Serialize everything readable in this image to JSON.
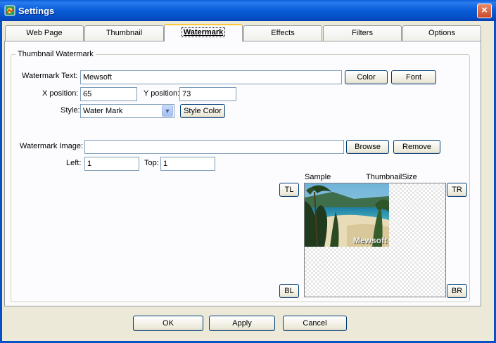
{
  "window": {
    "title": "Settings",
    "close_label": "×"
  },
  "tabs": [
    {
      "label": "Web Page"
    },
    {
      "label": "Thumbnail"
    },
    {
      "label": "Watermark"
    },
    {
      "label": "Effects"
    },
    {
      "label": "Filters"
    },
    {
      "label": "Options"
    }
  ],
  "active_tab": "Watermark",
  "group": {
    "title": "Thumbnail Watermark"
  },
  "text_wm": {
    "text_label": "Watermark Text:",
    "text_value": "Mewsoft",
    "color_button": "Color",
    "font_button": "Font",
    "x_label": "X position:",
    "x_value": "65",
    "y_label": "Y position:",
    "y_value": "73",
    "style_label": "Style:",
    "style_value": "Water Mark",
    "style_color_button": "Style Color"
  },
  "image_wm": {
    "image_label": "Watermark Image:",
    "image_value": "",
    "browse_button": "Browse",
    "remove_button": "Remove",
    "left_label": "Left:",
    "left_value": "1",
    "top_label": "Top:",
    "top_value": "1"
  },
  "preview": {
    "sample_label": "Sample",
    "size_label": "ThumbnailSize",
    "tl": "TL",
    "tr": "TR",
    "bl": "BL",
    "br": "BR",
    "watermark_text": "Mewsoft"
  },
  "footer": {
    "ok": "OK",
    "apply": "Apply",
    "cancel": "Cancel"
  },
  "colors": {
    "titlebar": "#0a5fd8",
    "dialog_bg": "#ece9d8",
    "panel_bg": "#fcfcfe",
    "active_tab_accent": "#ffc83c"
  }
}
